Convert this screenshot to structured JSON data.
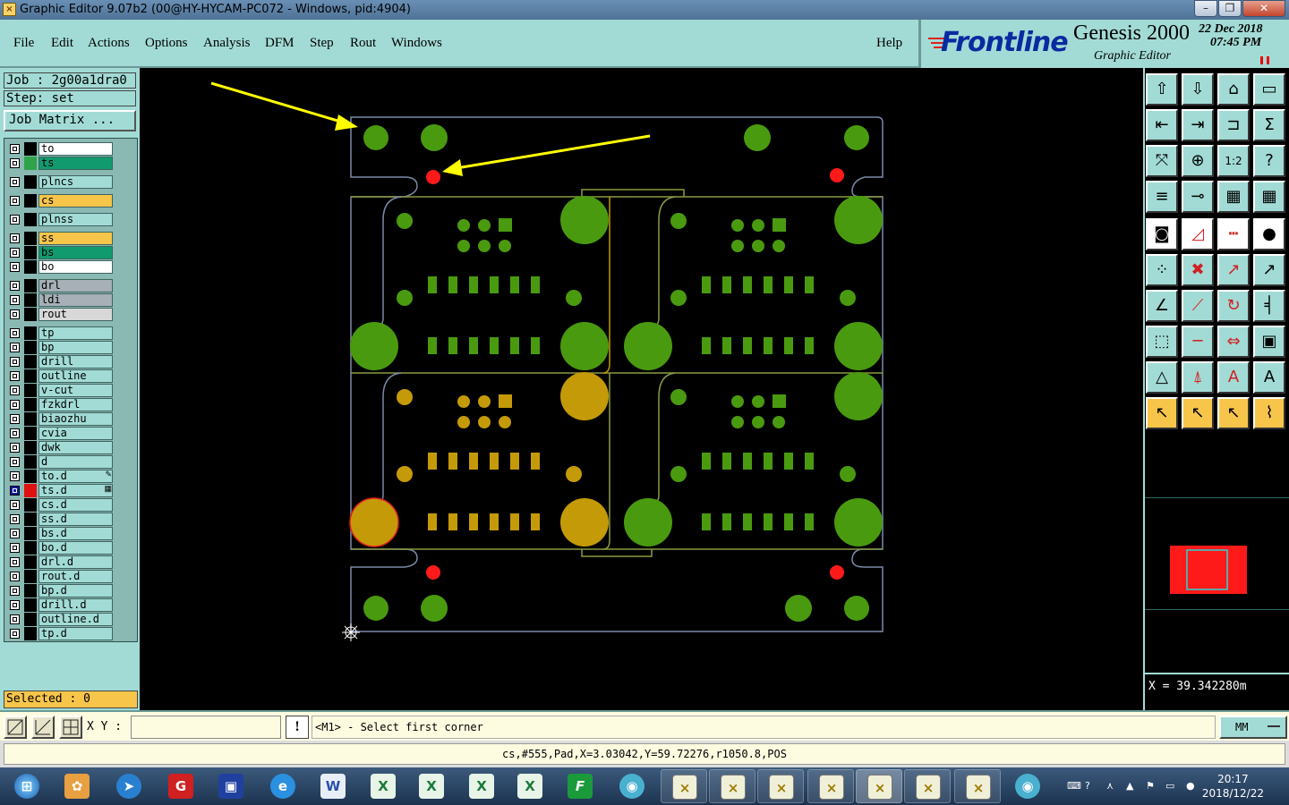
{
  "window": {
    "title": "Graphic Editor 9.07b2 (00@HY-HYCAM-PC072 - Windows, pid:4904)"
  },
  "menu": [
    "File",
    "Edit",
    "Actions",
    "Options",
    "Analysis",
    "DFM",
    "Step",
    "Rout",
    "Windows"
  ],
  "help": "Help",
  "brand": {
    "logo": "Frontline",
    "product": "Genesis 2000",
    "subtitle": "Graphic Editor",
    "date": "22 Dec 2018",
    "time": "07:45 PM"
  },
  "job": {
    "job_label": "Job : 2g00a1dra0",
    "step_label": "Step: set",
    "matrix_button": "Job Matrix ..."
  },
  "layers": [
    {
      "name": "to",
      "bg": "#ffffff",
      "swatch": "#000000",
      "group": 0
    },
    {
      "name": "ts",
      "bg": "#119a6e",
      "swatch": "#2ea34a",
      "group": 0
    },
    {
      "name": "plncs",
      "bg": "#a2dbd5",
      "swatch": "#000000",
      "group": 1
    },
    {
      "name": "cs",
      "bg": "#f7c54a",
      "swatch": "#000000",
      "group": 2
    },
    {
      "name": "plnss",
      "bg": "#a2dbd5",
      "swatch": "#000000",
      "group": 3
    },
    {
      "name": "ss",
      "bg": "#f7c54a",
      "swatch": "#000000",
      "group": 4
    },
    {
      "name": "bs",
      "bg": "#119a6e",
      "swatch": "#000000",
      "group": 4
    },
    {
      "name": "bo",
      "bg": "#ffffff",
      "swatch": "#000000",
      "group": 4
    },
    {
      "name": "drl",
      "bg": "#a6b0b6",
      "swatch": "#000000",
      "group": 5
    },
    {
      "name": "ldi",
      "bg": "#a6b0b6",
      "swatch": "#000000",
      "group": 5
    },
    {
      "name": "rout",
      "bg": "#d8d8d8",
      "swatch": "#000000",
      "group": 5
    },
    {
      "name": "tp",
      "bg": "#a2dbd5",
      "swatch": "#000000",
      "group": 6
    },
    {
      "name": "bp",
      "bg": "#a2dbd5",
      "swatch": "#000000",
      "group": 6
    },
    {
      "name": "drill",
      "bg": "#a2dbd5",
      "swatch": "#000000",
      "group": 6
    },
    {
      "name": "outline",
      "bg": "#a2dbd5",
      "swatch": "#000000",
      "group": 6
    },
    {
      "name": "v-cut",
      "bg": "#a2dbd5",
      "swatch": "#000000",
      "group": 6
    },
    {
      "name": "fzkdrl",
      "bg": "#a2dbd5",
      "swatch": "#000000",
      "group": 6
    },
    {
      "name": "biaozhu",
      "bg": "#a2dbd5",
      "swatch": "#000000",
      "group": 6
    },
    {
      "name": "cvia",
      "bg": "#a2dbd5",
      "swatch": "#000000",
      "group": 6
    },
    {
      "name": "dwk",
      "bg": "#a2dbd5",
      "swatch": "#000000",
      "group": 6
    },
    {
      "name": "d",
      "bg": "#a2dbd5",
      "swatch": "#000000",
      "group": 6
    },
    {
      "name": "to.d",
      "bg": "#a2dbd5",
      "swatch": "#000000",
      "group": 6,
      "mark": "✎"
    },
    {
      "name": "ts.d",
      "bg": "#a2dbd5",
      "swatch": "#e01010",
      "group": 6,
      "mark": "▦",
      "active": true
    },
    {
      "name": "cs.d",
      "bg": "#a2dbd5",
      "swatch": "#000000",
      "group": 6
    },
    {
      "name": "ss.d",
      "bg": "#a2dbd5",
      "swatch": "#000000",
      "group": 6
    },
    {
      "name": "bs.d",
      "bg": "#a2dbd5",
      "swatch": "#000000",
      "group": 6
    },
    {
      "name": "bo.d",
      "bg": "#a2dbd5",
      "swatch": "#000000",
      "group": 6
    },
    {
      "name": "drl.d",
      "bg": "#a2dbd5",
      "swatch": "#000000",
      "group": 6
    },
    {
      "name": "rout.d",
      "bg": "#a2dbd5",
      "swatch": "#000000",
      "group": 6
    },
    {
      "name": "bp.d",
      "bg": "#a2dbd5",
      "swatch": "#000000",
      "group": 6
    },
    {
      "name": "drill.d",
      "bg": "#a2dbd5",
      "swatch": "#000000",
      "group": 6
    },
    {
      "name": "outline.d",
      "bg": "#a2dbd5",
      "swatch": "#000000",
      "group": 6
    },
    {
      "name": "tp.d",
      "bg": "#a2dbd5",
      "swatch": "#000000",
      "group": 6
    }
  ],
  "selected": "Selected : 0",
  "coord_readout": "X = 39.342280m",
  "command": {
    "xy_label": "X Y :",
    "xy_value": "",
    "prompt": "<M1> - Select first corner",
    "units": "MM"
  },
  "status": "cs,#555,Pad,X=3.03042,Y=59.72276,r1050.8,POS",
  "taskbar": {
    "time": "20:17",
    "date": "2018/12/22"
  },
  "colors": {
    "panel": "#a2dbd5",
    "green_pad": "#4a9a10",
    "gold_pad": "#c49a08",
    "selected_red": "#ff1a1a",
    "arrow": "#ffff00",
    "outline": "#7a8aa8",
    "trace": "#8a9a40"
  }
}
